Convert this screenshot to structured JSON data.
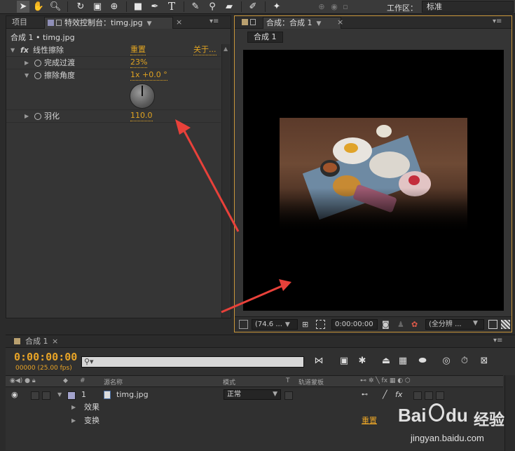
{
  "toolbar": {
    "tools": [
      "selection-tool",
      "hand-tool",
      "zoom-tool",
      "rotate-tool",
      "camera-tool",
      "pan-behind-tool",
      "rectangle-tool",
      "pen-tool",
      "text-tool",
      "brush-tool",
      "clone-stamp-tool",
      "eraser-tool",
      "roto-brush-tool",
      "puppet-tool"
    ],
    "workspace_label": "工作区：",
    "workspace_value": "标准"
  },
  "left_panel": {
    "tab_project": "项目",
    "tab_effects": "特效控制台：timg.jpg",
    "breadcrumb": "合成 1 • timg.jpg",
    "effect": {
      "name": "线性擦除",
      "reset": "重置",
      "about": "关于...",
      "props": [
        {
          "label": "完成过渡",
          "value": "23%"
        },
        {
          "label": "擦除角度",
          "value": "1x +0.0 °"
        },
        {
          "label": "羽化",
          "value": "110.0"
        }
      ]
    }
  },
  "comp_panel": {
    "tab_title": "合成：合成 1",
    "subtab": "合成 1",
    "viewer_bar": {
      "zoom": "(74.6 ...",
      "timecode": "0:00:00:00",
      "resolution": "(全分辨 ..."
    }
  },
  "timeline": {
    "tab": "合成 1",
    "timecode": "0:00:00:00",
    "fps": "00000 (25.00 fps)",
    "search_placeholder": "",
    "headers": {
      "num": "#",
      "source": "源名称",
      "mode": "模式",
      "t": "T",
      "trkmat": "轨道蒙板",
      "switches": "fx"
    },
    "layer": {
      "index": "1",
      "name": "timg.jpg",
      "mode": "正常"
    },
    "groups": [
      {
        "label": "效果"
      },
      {
        "label": "变换",
        "reset": "重置"
      }
    ]
  },
  "watermark": {
    "brand": "Bai",
    "brand2": "du",
    "jingyan": "经验",
    "url": "jingyan.baidu.com"
  },
  "colors": {
    "accent_orange": "#e8a427",
    "comp_border": "#c9963a",
    "arrow_red": "#e8413a"
  }
}
